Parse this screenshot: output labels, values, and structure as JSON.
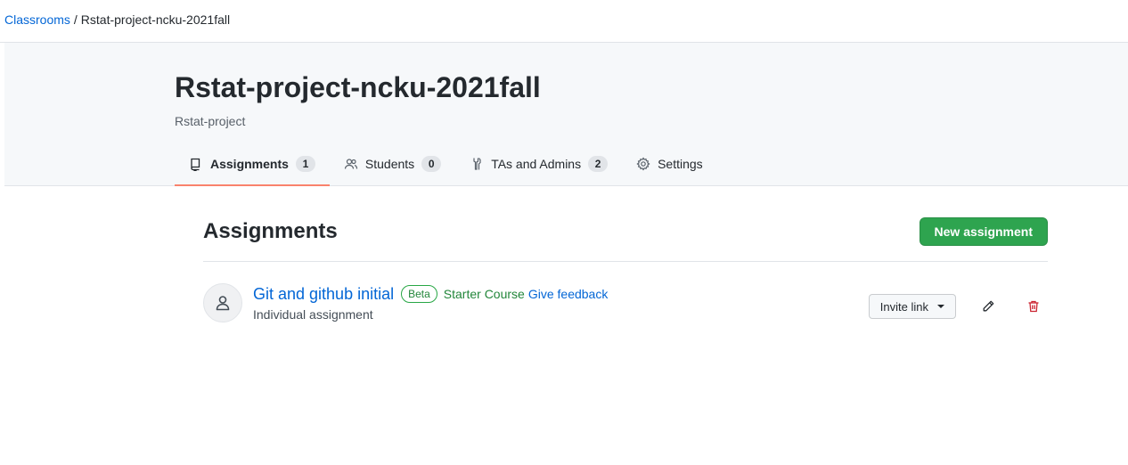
{
  "breadcrumb": {
    "root": "Classrooms",
    "separator": "/",
    "current": "Rstat-project-ncku-2021fall"
  },
  "header": {
    "title": "Rstat-project-ncku-2021fall",
    "org": "Rstat-project"
  },
  "tabs": [
    {
      "label": "Assignments",
      "count": "1",
      "icon": "book-icon",
      "active": true
    },
    {
      "label": "Students",
      "count": "0",
      "icon": "people-icon",
      "active": false
    },
    {
      "label": "TAs and Admins",
      "count": "2",
      "icon": "tools-icon",
      "active": false
    },
    {
      "label": "Settings",
      "icon": "gear-icon",
      "active": false
    }
  ],
  "main": {
    "title": "Assignments",
    "new_button": "New assignment",
    "assignments": [
      {
        "title": "Git and github initial",
        "badge": "Beta",
        "starter": "Starter Course",
        "feedback": "Give feedback",
        "type": "Individual assignment",
        "invite_label": "Invite link",
        "icons": [
          "person-icon",
          "pencil-icon",
          "trash-icon"
        ]
      }
    ]
  },
  "colors": {
    "accent_link": "#0366d6",
    "primary_green": "#2ea44f",
    "tab_underline": "#f9826c",
    "danger": "#cb2431"
  }
}
